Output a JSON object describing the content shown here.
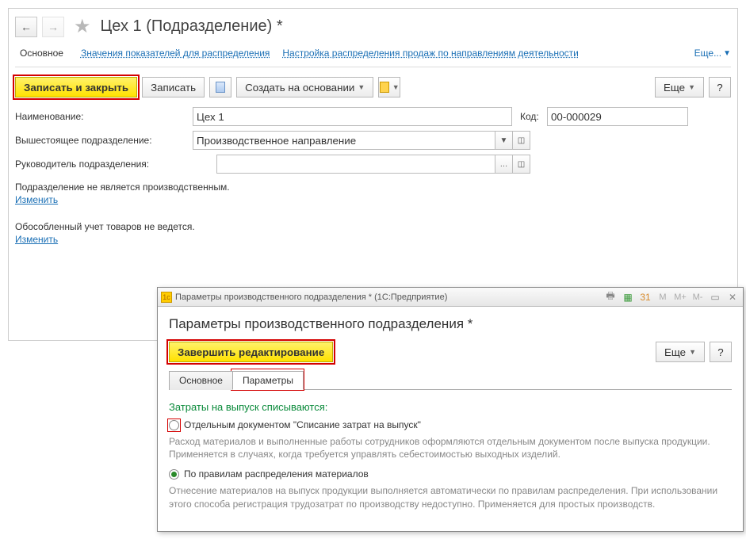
{
  "main": {
    "title": "Цех 1 (Подразделение) *",
    "tabs": {
      "main": "Основное",
      "values": "Значения показателей для распределения",
      "sales": "Настройка распределения продаж по направлениям деятельности",
      "more": "Еще..."
    },
    "toolbar": {
      "save_close": "Записать и закрыть",
      "save": "Записать",
      "create_based": "Создать на основании",
      "more": "Еще"
    },
    "fields": {
      "name_label": "Наименование:",
      "name_value": "Цех 1",
      "code_label": "Код:",
      "code_value": "00-000029",
      "parent_label": "Вышестоящее подразделение:",
      "parent_value": "Производственное направление",
      "manager_label": "Руководитель подразделения:",
      "manager_value": ""
    },
    "info1": "Подразделение не является производственным.",
    "change": "Изменить",
    "info2": "Обособленный учет товаров не ведется."
  },
  "popup": {
    "window_title": "Параметры производственного подразделения * (1С:Предприятие)",
    "heading": "Параметры производственного подразделения *",
    "finish": "Завершить редактирование",
    "more": "Еще",
    "tabs": {
      "main": "Основное",
      "params": "Параметры"
    },
    "section": "Затраты на выпуск списываются:",
    "opt1": "Отдельным документом \"Списание затрат на выпуск\"",
    "desc1": "Расход материалов и выполненные работы сотрудников оформляются отдельным документом после выпуска продукции. Применяется в случаях, когда требуется управлять себестоимостью выходных изделий.",
    "opt2": "По правилам распределения материалов",
    "desc2": "Отнесение материалов на выпуск продукции выполняется автоматически по правилам распределения. При использовании этого способа регистрация трудозатрат по производству недоступно. Применяется для простых производств."
  }
}
